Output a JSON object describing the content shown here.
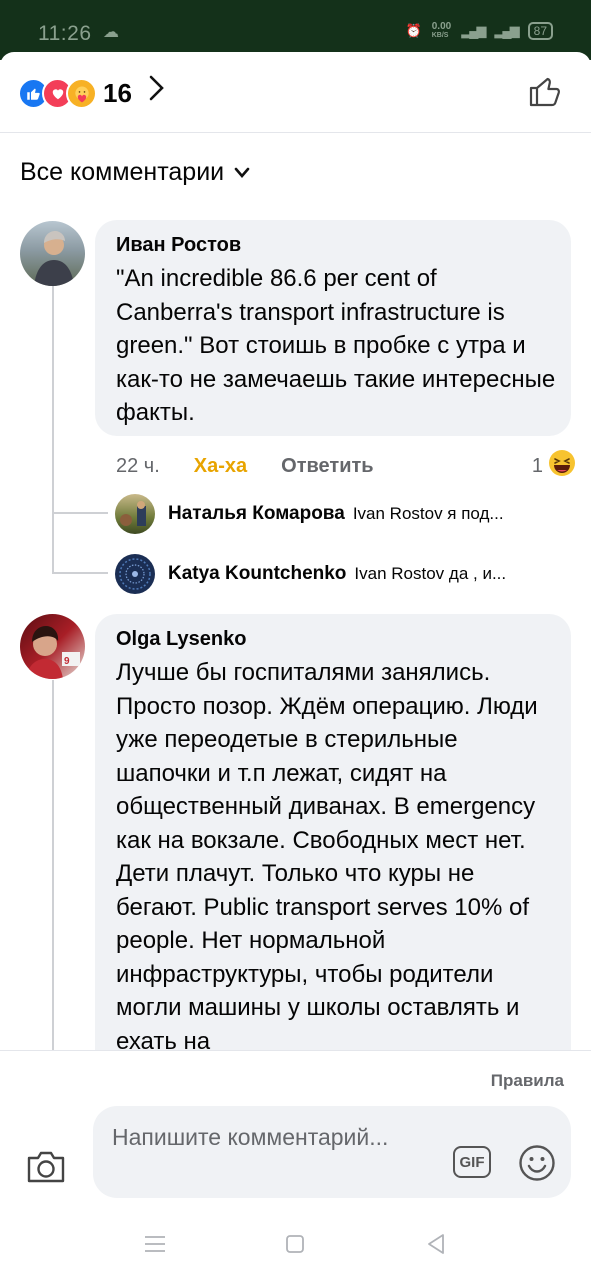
{
  "status": {
    "time": "11:26",
    "net_speed": "0.00",
    "net_unit": "KB/S",
    "battery": "87"
  },
  "reactions": {
    "count": "16"
  },
  "filter_label": "Все комментарии",
  "comments": [
    {
      "author": "Иван Ростов",
      "text": "\"An incredible 86.6 per cent of Canberra's transport infrastructure is green.\" Вот стоишь в пробке с утра и как-то не замечаешь такие интересные факты.",
      "time": "22 ч.",
      "reaction_label": "Ха-ха",
      "reply_label": "Ответить",
      "reaction_count": "1",
      "replies": [
        {
          "name": "Наталья Комарова",
          "snippet": "Ivan Rostov я под..."
        },
        {
          "name": "Katya Kountchenko",
          "snippet": "Ivan Rostov да ,  и..."
        }
      ]
    },
    {
      "author": "Olga Lysenko",
      "text": "Лучше бы госпиталями занялись. Просто позор. Ждём операцию. Люди уже переодетые в стерильные шапочки и т.п лежат, сидят на общественный диванах. В emergency как на вокзале. Свободных мест нет. Дети плачут. Только что куры не бегают. Public transport serves 10% of people. Нет нормальной инфраструктуры, чтобы родители могли машины у школы оставлять и ехать на"
    }
  ],
  "composer": {
    "rules": "Правила",
    "placeholder": "Напишите комментарий...",
    "gif": "GIF"
  }
}
